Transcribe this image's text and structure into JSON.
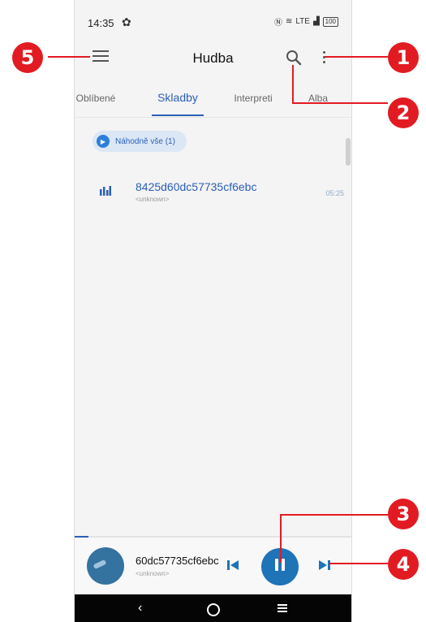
{
  "status": {
    "time": "14:35",
    "network": "LTE",
    "battery": "100"
  },
  "appbar": {
    "title": "Hudba"
  },
  "tabs": [
    {
      "label": "Oblíbené",
      "active": false
    },
    {
      "label": "Skladby",
      "active": true
    },
    {
      "label": "Interpreti",
      "active": false
    },
    {
      "label": "Alba",
      "active": false
    }
  ],
  "shuffle": {
    "label": "Náhodně vše (1)"
  },
  "songs": [
    {
      "title": "8425d60dc57735cf6ebc",
      "artist": "<unknown>",
      "duration": "05:25"
    }
  ],
  "player": {
    "title": "60dc57735cf6ebc",
    "artist": "<unknown>",
    "progress_fraction": 0.05,
    "state": "playing"
  },
  "annotations": [
    "1",
    "2",
    "3",
    "4",
    "5"
  ],
  "colors": {
    "accent": "#2b5fb5",
    "play_button": "#1f73b7",
    "annotation": "#e21b23"
  }
}
